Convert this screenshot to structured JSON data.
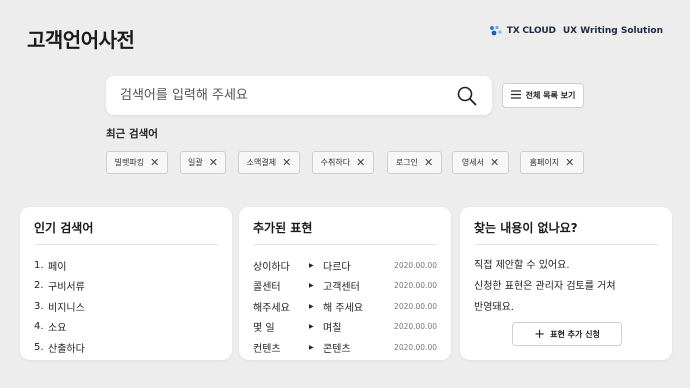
{
  "page_title": "고객언어사전",
  "brand": {
    "name": "TX CLOUD",
    "tagline": "UX Writing Solution"
  },
  "search": {
    "placeholder": "검색어를 입력해 주세요"
  },
  "list_all_label": "전체 목록 보기",
  "recent": {
    "title": "최근 검색어",
    "chips": [
      "빌렛파킹",
      "일괄",
      "소액결제",
      "수취하다",
      "로그인",
      "영세서",
      "홈페이지"
    ]
  },
  "popular": {
    "title": "인기 검색어",
    "items": [
      {
        "num": "1.",
        "text": "페이"
      },
      {
        "num": "2.",
        "text": "구비서류"
      },
      {
        "num": "3.",
        "text": "비지니스"
      },
      {
        "num": "4.",
        "text": "소요"
      },
      {
        "num": "5.",
        "text": "산출하다"
      }
    ]
  },
  "added": {
    "title": "추가된 표현",
    "arrow": "▶",
    "rows": [
      {
        "from": "상이하다",
        "to": "다르다",
        "date": "2020.00.00"
      },
      {
        "from": "콜센터",
        "to": "고객센터",
        "date": "2020.00.00"
      },
      {
        "from": "해주세요",
        "to": "해 주세요",
        "date": "2020.00.00"
      },
      {
        "from": "몇 일",
        "to": "며칠",
        "date": "2020.00.00"
      },
      {
        "from": "컨텐츠",
        "to": "콘텐츠",
        "date": "2020.00.00"
      }
    ]
  },
  "help": {
    "title": "찾는 내용이 없나요?",
    "line1": "직접 제안할 수 있어요.",
    "line2": "신청한 표현은 관리자 검토를 거쳐",
    "line3": "반영돼요.",
    "button_label": "표현 추가 신청",
    "plus": "+"
  },
  "colors": {
    "background": "#ededed",
    "brand_blue": "#2f7fd6",
    "brand_text": "#1d2a44"
  }
}
